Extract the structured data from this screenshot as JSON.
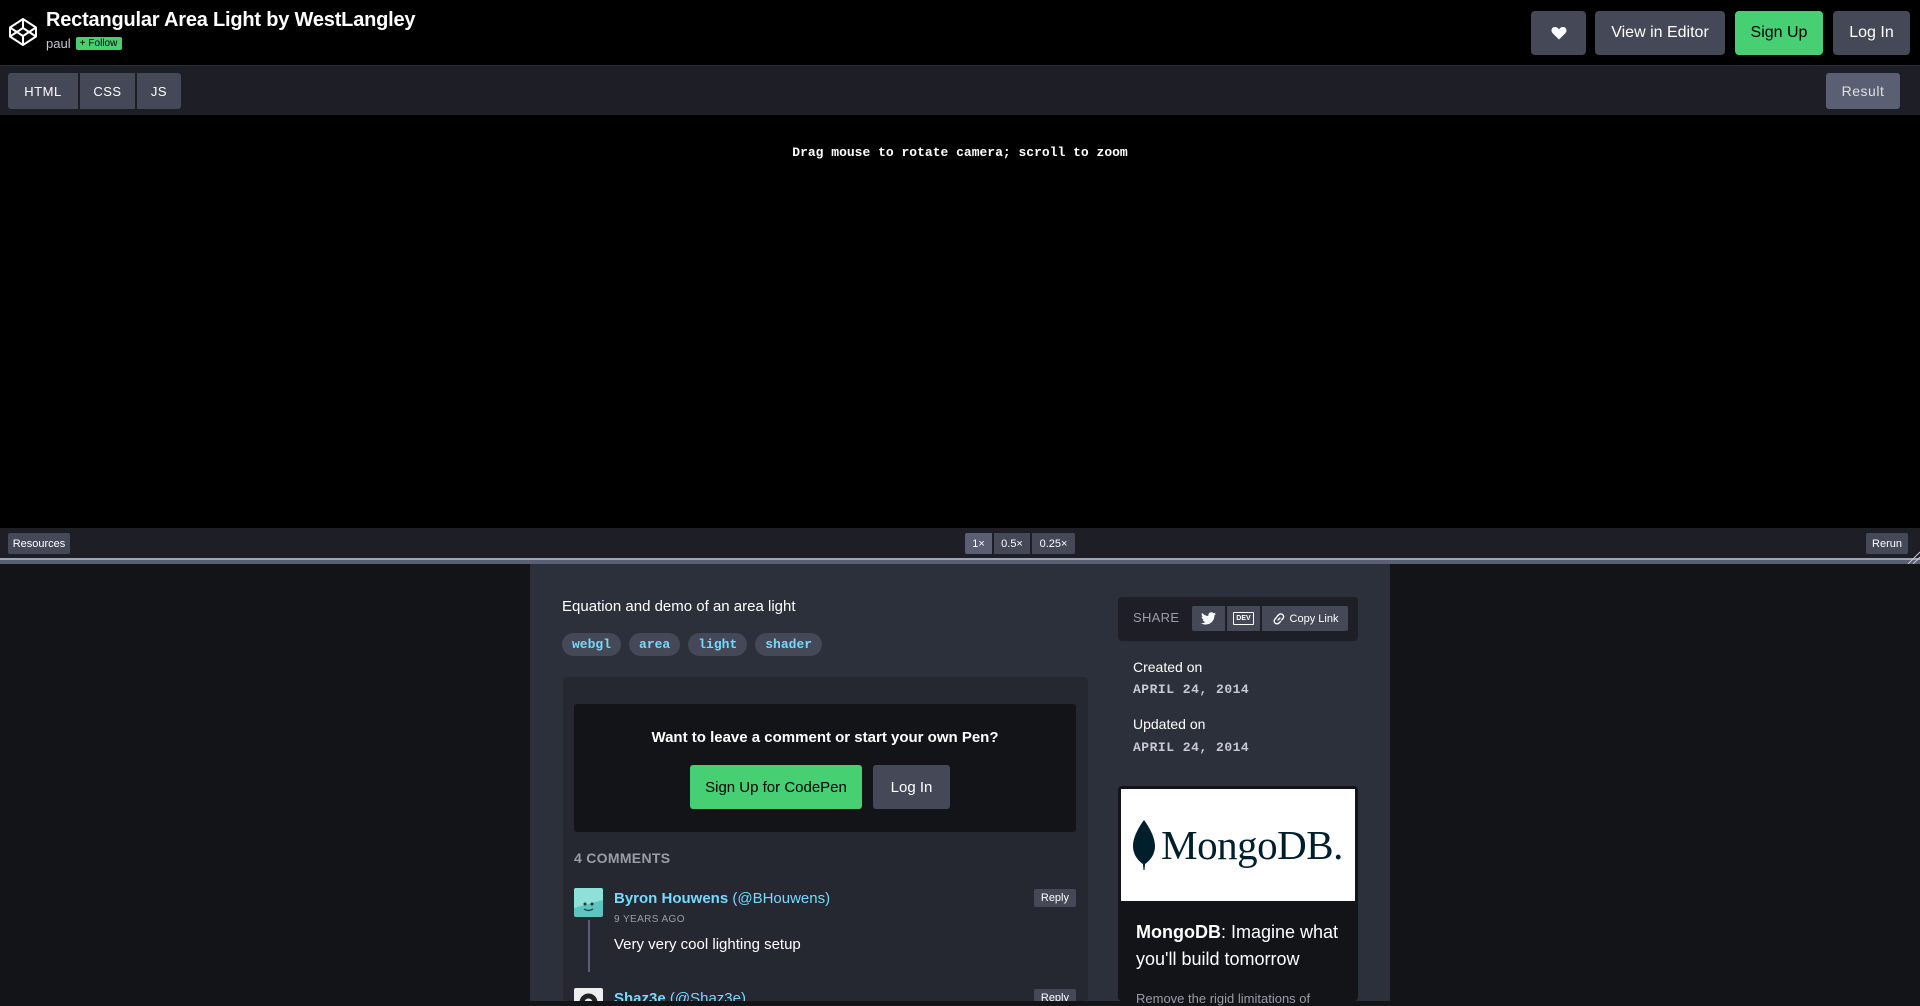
{
  "header": {
    "title": "Rectangular Area Light by WestLangley",
    "author": "paul",
    "follow_label": "Follow",
    "view_editor_label": "View in Editor",
    "signup_label": "Sign Up",
    "login_label": "Log In"
  },
  "tabs": {
    "html": "HTML",
    "css": "CSS",
    "js": "JS",
    "result": "Result"
  },
  "result": {
    "info_text": "Drag mouse to rotate camera; scroll to zoom"
  },
  "bottombar": {
    "resources_label": "Resources",
    "zoom_options": [
      "1×",
      "0.5×",
      "0.25×"
    ],
    "rerun_label": "Rerun"
  },
  "details": {
    "description": "Equation and demo of an area light",
    "tags": [
      "webgl",
      "area",
      "light",
      "shader"
    ]
  },
  "cta": {
    "title": "Want to leave a comment or start your own Pen?",
    "signup_label": "Sign Up for CodePen",
    "login_label": "Log In"
  },
  "comments": {
    "count_label": "4 COMMENTS",
    "items": [
      {
        "author": "Byron Houwens",
        "handle": "(@BHouwens)",
        "time": "9 YEARS AGO",
        "text": "Very very cool lighting setup",
        "reply_label": "Reply"
      },
      {
        "author": "Shaz3e",
        "handle": "(@Shaz3e)",
        "reply_label": "Reply"
      }
    ]
  },
  "sidebar": {
    "share_label": "SHARE",
    "dev_label": "DEV",
    "copy_link_label": "Copy Link",
    "created_label": "Created on",
    "created_date": "APRIL 24, 2014",
    "updated_label": "Updated on",
    "updated_date": "APRIL 24, 2014"
  },
  "ad": {
    "brand": "MongoDB.",
    "title_brand": "MongoDB",
    "title_rest": ": Imagine what you'll build tomorrow",
    "body": "Remove the rigid limitations of"
  },
  "colors": {
    "accent_green": "#47cf73",
    "link_blue": "#76daff",
    "button_gray": "#444857"
  }
}
